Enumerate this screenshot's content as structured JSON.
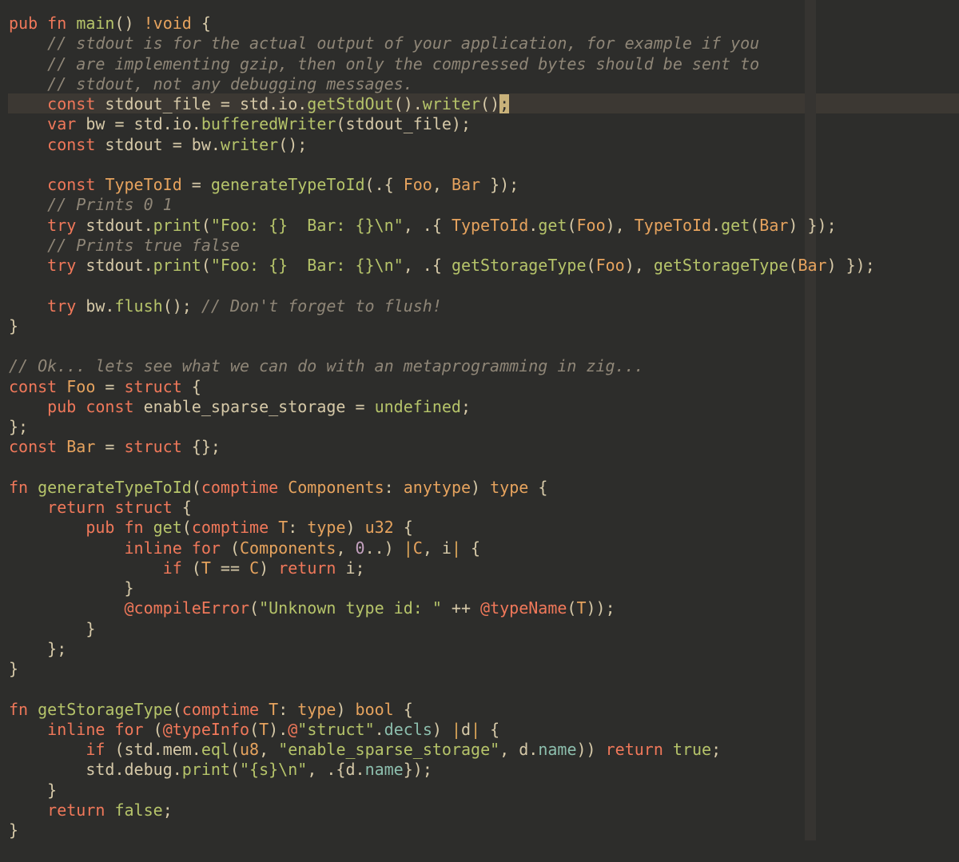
{
  "editor": {
    "theme": {
      "background": "#2d2d2b",
      "current_line": "#3c3833",
      "ruler": "#363431",
      "keyword": "#f0785a",
      "type": "#e6a35e",
      "function": "#b6c46a",
      "comment": "#8f8677",
      "text": "#d6c9a8",
      "field": "#8dbfae",
      "number": "#c5a2c0",
      "cursor": "#c9b27a"
    },
    "cursor_line": 4,
    "lines": [
      [
        [
          "kw",
          "pub"
        ],
        [
          "id",
          " "
        ],
        [
          "kw",
          "fn"
        ],
        [
          "id",
          " "
        ],
        [
          "fn",
          "main"
        ],
        [
          "id",
          "() "
        ],
        [
          "ty",
          "!void"
        ],
        [
          "id",
          " {"
        ]
      ],
      [
        [
          "id",
          "    "
        ],
        [
          "cm",
          "// stdout is for the actual output of your application, for example if you"
        ]
      ],
      [
        [
          "id",
          "    "
        ],
        [
          "cm",
          "// are implementing gzip, then only the compressed bytes should be sent to"
        ]
      ],
      [
        [
          "id",
          "    "
        ],
        [
          "cm",
          "// stdout, not any debugging messages."
        ]
      ],
      [
        [
          "id",
          "    "
        ],
        [
          "kw",
          "const"
        ],
        [
          "id",
          " stdout_file = std.io."
        ],
        [
          "fn",
          "getStdOut"
        ],
        [
          "id",
          "()."
        ],
        [
          "fn",
          "writer"
        ],
        [
          "id",
          "()"
        ],
        [
          "cursor",
          ";"
        ]
      ],
      [
        [
          "id",
          "    "
        ],
        [
          "kw",
          "var"
        ],
        [
          "id",
          " bw = std.io."
        ],
        [
          "fn",
          "bufferedWriter"
        ],
        [
          "id",
          "(stdout_file);"
        ]
      ],
      [
        [
          "id",
          "    "
        ],
        [
          "kw",
          "const"
        ],
        [
          "id",
          " stdout = bw."
        ],
        [
          "fn",
          "writer"
        ],
        [
          "id",
          "();"
        ]
      ],
      [],
      [
        [
          "id",
          "    "
        ],
        [
          "kw",
          "const"
        ],
        [
          "id",
          " "
        ],
        [
          "ty",
          "TypeToId"
        ],
        [
          "id",
          " = "
        ],
        [
          "fn",
          "generateTypeToId"
        ],
        [
          "id",
          "(.{ "
        ],
        [
          "ty",
          "Foo"
        ],
        [
          "id",
          ", "
        ],
        [
          "ty",
          "Bar"
        ],
        [
          "id",
          " });"
        ]
      ],
      [
        [
          "id",
          "    "
        ],
        [
          "cm",
          "// Prints 0 1"
        ]
      ],
      [
        [
          "id",
          "    "
        ],
        [
          "kw",
          "try"
        ],
        [
          "id",
          " stdout."
        ],
        [
          "fn",
          "print"
        ],
        [
          "id",
          "("
        ],
        [
          "str",
          "\"Foo: {}  Bar: {}\\n\""
        ],
        [
          "id",
          ", .{ "
        ],
        [
          "ty",
          "TypeToId"
        ],
        [
          "id",
          "."
        ],
        [
          "fn",
          "get"
        ],
        [
          "id",
          "("
        ],
        [
          "ty",
          "Foo"
        ],
        [
          "id",
          "), "
        ],
        [
          "ty",
          "TypeToId"
        ],
        [
          "id",
          "."
        ],
        [
          "fn",
          "get"
        ],
        [
          "id",
          "("
        ],
        [
          "ty",
          "Bar"
        ],
        [
          "id",
          ") });"
        ]
      ],
      [
        [
          "id",
          "    "
        ],
        [
          "cm",
          "// Prints true false"
        ]
      ],
      [
        [
          "id",
          "    "
        ],
        [
          "kw",
          "try"
        ],
        [
          "id",
          " stdout."
        ],
        [
          "fn",
          "print"
        ],
        [
          "id",
          "("
        ],
        [
          "str",
          "\"Foo: {}  Bar: {}\\n\""
        ],
        [
          "id",
          ", .{ "
        ],
        [
          "fn",
          "getStorageType"
        ],
        [
          "id",
          "("
        ],
        [
          "ty",
          "Foo"
        ],
        [
          "id",
          "), "
        ],
        [
          "fn",
          "getStorageType"
        ],
        [
          "id",
          "("
        ],
        [
          "ty",
          "Bar"
        ],
        [
          "id",
          ") });"
        ]
      ],
      [],
      [
        [
          "id",
          "    "
        ],
        [
          "kw",
          "try"
        ],
        [
          "id",
          " bw."
        ],
        [
          "fn",
          "flush"
        ],
        [
          "id",
          "(); "
        ],
        [
          "cm",
          "// Don't forget to flush!"
        ]
      ],
      [
        [
          "id",
          "}"
        ]
      ],
      [],
      [
        [
          "cm",
          "// Ok... lets see what we can do with an metaprogramming in zig..."
        ]
      ],
      [
        [
          "kw",
          "const"
        ],
        [
          "id",
          " "
        ],
        [
          "ty",
          "Foo"
        ],
        [
          "id",
          " = "
        ],
        [
          "kw",
          "struct"
        ],
        [
          "id",
          " {"
        ]
      ],
      [
        [
          "id",
          "    "
        ],
        [
          "kw",
          "pub"
        ],
        [
          "id",
          " "
        ],
        [
          "kw",
          "const"
        ],
        [
          "id",
          " enable_sparse_storage = "
        ],
        [
          "fn",
          "undefined"
        ],
        [
          "id",
          ";"
        ]
      ],
      [
        [
          "id",
          "};"
        ]
      ],
      [
        [
          "kw",
          "const"
        ],
        [
          "id",
          " "
        ],
        [
          "ty",
          "Bar"
        ],
        [
          "id",
          " = "
        ],
        [
          "kw",
          "struct"
        ],
        [
          "id",
          " {};"
        ]
      ],
      [],
      [
        [
          "kw",
          "fn"
        ],
        [
          "id",
          " "
        ],
        [
          "fn",
          "generateTypeToId"
        ],
        [
          "id",
          "("
        ],
        [
          "kw",
          "comptime"
        ],
        [
          "id",
          " "
        ],
        [
          "ty",
          "Components"
        ],
        [
          "id",
          ": "
        ],
        [
          "ty",
          "anytype"
        ],
        [
          "id",
          ") "
        ],
        [
          "ty",
          "type"
        ],
        [
          "id",
          " {"
        ]
      ],
      [
        [
          "id",
          "    "
        ],
        [
          "kw",
          "return"
        ],
        [
          "id",
          " "
        ],
        [
          "kw",
          "struct"
        ],
        [
          "id",
          " {"
        ]
      ],
      [
        [
          "id",
          "        "
        ],
        [
          "kw",
          "pub"
        ],
        [
          "id",
          " "
        ],
        [
          "kw",
          "fn"
        ],
        [
          "id",
          " "
        ],
        [
          "fn",
          "get"
        ],
        [
          "id",
          "("
        ],
        [
          "kw",
          "comptime"
        ],
        [
          "id",
          " "
        ],
        [
          "ty",
          "T"
        ],
        [
          "id",
          ": "
        ],
        [
          "ty",
          "type"
        ],
        [
          "id",
          ") "
        ],
        [
          "ty",
          "u32"
        ],
        [
          "id",
          " {"
        ]
      ],
      [
        [
          "id",
          "            "
        ],
        [
          "kw",
          "inline"
        ],
        [
          "id",
          " "
        ],
        [
          "kw",
          "for"
        ],
        [
          "id",
          " ("
        ],
        [
          "ty",
          "Components"
        ],
        [
          "id",
          ", "
        ],
        [
          "num",
          "0"
        ],
        [
          "id",
          "..) "
        ],
        [
          "op",
          "|"
        ],
        [
          "ty",
          "C"
        ],
        [
          "id",
          ", i"
        ],
        [
          "op",
          "|"
        ],
        [
          "id",
          " {"
        ]
      ],
      [
        [
          "id",
          "                "
        ],
        [
          "kw",
          "if"
        ],
        [
          "id",
          " ("
        ],
        [
          "ty",
          "T"
        ],
        [
          "id",
          " == "
        ],
        [
          "ty",
          "C"
        ],
        [
          "id",
          ") "
        ],
        [
          "kw",
          "return"
        ],
        [
          "id",
          " i;"
        ]
      ],
      [
        [
          "id",
          "            }"
        ]
      ],
      [
        [
          "id",
          "            "
        ],
        [
          "bi",
          "@compileError"
        ],
        [
          "id",
          "("
        ],
        [
          "str",
          "\"Unknown type id: \""
        ],
        [
          "id",
          " ++ "
        ],
        [
          "bi",
          "@typeName"
        ],
        [
          "id",
          "("
        ],
        [
          "ty",
          "T"
        ],
        [
          "id",
          "));"
        ]
      ],
      [
        [
          "id",
          "        }"
        ]
      ],
      [
        [
          "id",
          "    };"
        ]
      ],
      [
        [
          "id",
          "}"
        ]
      ],
      [],
      [
        [
          "kw",
          "fn"
        ],
        [
          "id",
          " "
        ],
        [
          "fn",
          "getStorageType"
        ],
        [
          "id",
          "("
        ],
        [
          "kw",
          "comptime"
        ],
        [
          "id",
          " "
        ],
        [
          "ty",
          "T"
        ],
        [
          "id",
          ": "
        ],
        [
          "ty",
          "type"
        ],
        [
          "id",
          ") "
        ],
        [
          "ty",
          "bool"
        ],
        [
          "id",
          " {"
        ]
      ],
      [
        [
          "id",
          "    "
        ],
        [
          "kw",
          "inline"
        ],
        [
          "id",
          " "
        ],
        [
          "kw",
          "for"
        ],
        [
          "id",
          " ("
        ],
        [
          "bi",
          "@typeInfo"
        ],
        [
          "id",
          "("
        ],
        [
          "ty",
          "T"
        ],
        [
          "id",
          ")."
        ],
        [
          "bi",
          "@"
        ],
        [
          "str",
          "\"struct\""
        ],
        [
          "id",
          "."
        ],
        [
          "fld",
          "decls"
        ],
        [
          "id",
          ") "
        ],
        [
          "op",
          "|"
        ],
        [
          "id",
          "d"
        ],
        [
          "op",
          "|"
        ],
        [
          "id",
          " {"
        ]
      ],
      [
        [
          "id",
          "        "
        ],
        [
          "kw",
          "if"
        ],
        [
          "id",
          " (std.mem."
        ],
        [
          "fn",
          "eql"
        ],
        [
          "id",
          "("
        ],
        [
          "ty",
          "u8"
        ],
        [
          "id",
          ", "
        ],
        [
          "str",
          "\"enable_sparse_storage\""
        ],
        [
          "id",
          ", d."
        ],
        [
          "fld",
          "name"
        ],
        [
          "id",
          ")) "
        ],
        [
          "kw",
          "return"
        ],
        [
          "id",
          " "
        ],
        [
          "fn",
          "true"
        ],
        [
          "id",
          ";"
        ]
      ],
      [
        [
          "id",
          "        std.debug."
        ],
        [
          "fn",
          "print"
        ],
        [
          "id",
          "("
        ],
        [
          "str",
          "\"{s}\\n\""
        ],
        [
          "id",
          ", .{d."
        ],
        [
          "fld",
          "name"
        ],
        [
          "id",
          "});"
        ]
      ],
      [
        [
          "id",
          "    }"
        ]
      ],
      [
        [
          "id",
          "    "
        ],
        [
          "kw",
          "return"
        ],
        [
          "id",
          " "
        ],
        [
          "fn",
          "false"
        ],
        [
          "id",
          ";"
        ]
      ],
      [
        [
          "id",
          "}"
        ]
      ]
    ]
  }
}
